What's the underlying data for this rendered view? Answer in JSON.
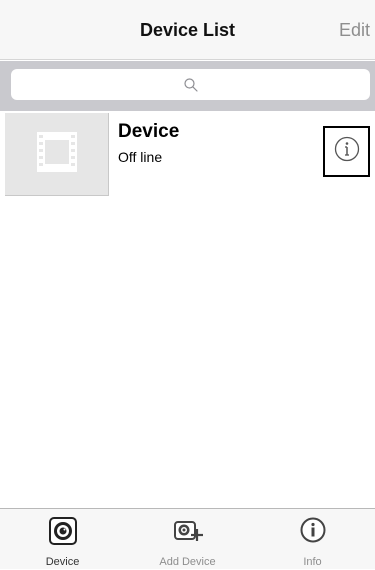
{
  "navbar": {
    "title": "Device List",
    "edit_label": "Edit"
  },
  "search": {
    "placeholder": ""
  },
  "devices": [
    {
      "name": "Device",
      "status": "Off line"
    }
  ],
  "tabbar": {
    "tabs": [
      {
        "label": "Device",
        "icon": "camera-icon",
        "active": true
      },
      {
        "label": "Add Device",
        "icon": "add-camera-icon",
        "active": false
      },
      {
        "label": "Info",
        "icon": "info-icon",
        "active": false
      }
    ]
  },
  "colors": {
    "navbar_bg": "#f7f7f7",
    "search_bar_bg": "#c9c9ce",
    "thumb_bg": "#e6e6e6",
    "inactive_text": "#8e8e8e"
  }
}
